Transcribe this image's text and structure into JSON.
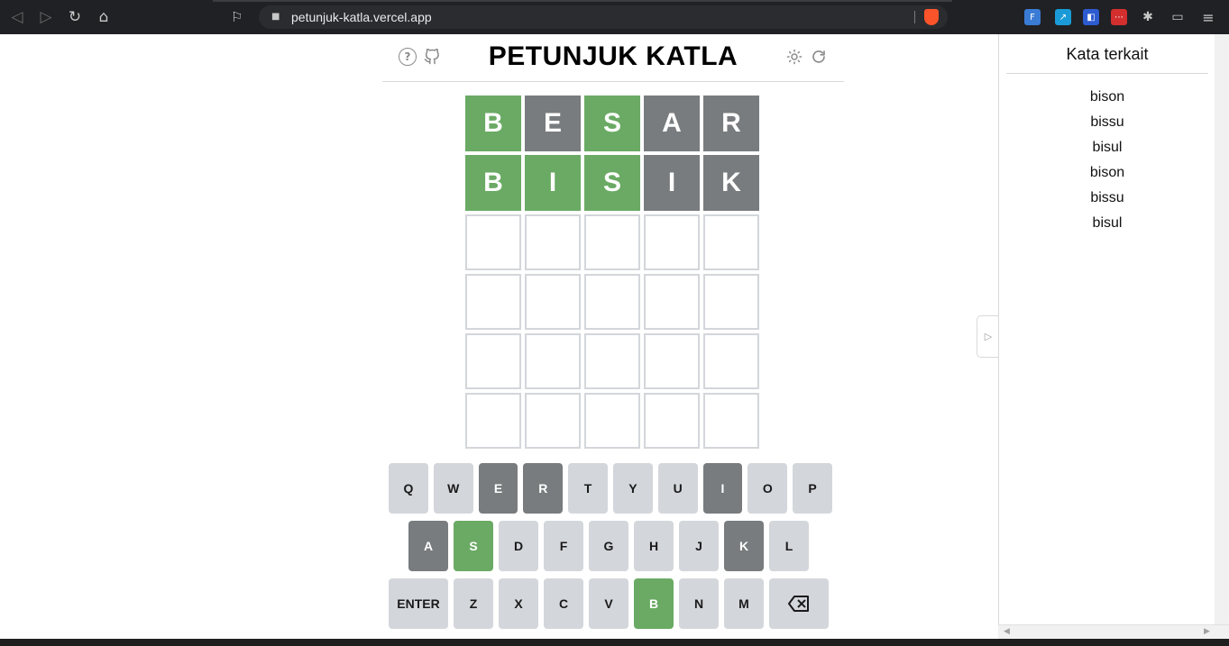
{
  "browser": {
    "url": "petunjuk-katla.vercel.app"
  },
  "app": {
    "title": "PETUNJUK KATLA"
  },
  "board": [
    [
      {
        "l": "B",
        "s": "correct"
      },
      {
        "l": "E",
        "s": "absent"
      },
      {
        "l": "S",
        "s": "correct"
      },
      {
        "l": "A",
        "s": "absent"
      },
      {
        "l": "R",
        "s": "absent"
      }
    ],
    [
      {
        "l": "B",
        "s": "correct"
      },
      {
        "l": "I",
        "s": "correct"
      },
      {
        "l": "S",
        "s": "correct"
      },
      {
        "l": "I",
        "s": "absent"
      },
      {
        "l": "K",
        "s": "absent"
      }
    ],
    [
      {
        "l": "",
        "s": "empty"
      },
      {
        "l": "",
        "s": "empty"
      },
      {
        "l": "",
        "s": "empty"
      },
      {
        "l": "",
        "s": "empty"
      },
      {
        "l": "",
        "s": "empty"
      }
    ],
    [
      {
        "l": "",
        "s": "empty"
      },
      {
        "l": "",
        "s": "empty"
      },
      {
        "l": "",
        "s": "empty"
      },
      {
        "l": "",
        "s": "empty"
      },
      {
        "l": "",
        "s": "empty"
      }
    ],
    [
      {
        "l": "",
        "s": "empty"
      },
      {
        "l": "",
        "s": "empty"
      },
      {
        "l": "",
        "s": "empty"
      },
      {
        "l": "",
        "s": "empty"
      },
      {
        "l": "",
        "s": "empty"
      }
    ],
    [
      {
        "l": "",
        "s": "empty"
      },
      {
        "l": "",
        "s": "empty"
      },
      {
        "l": "",
        "s": "empty"
      },
      {
        "l": "",
        "s": "empty"
      },
      {
        "l": "",
        "s": "empty"
      }
    ]
  ],
  "keyboard": [
    [
      {
        "k": "Q",
        "s": ""
      },
      {
        "k": "W",
        "s": ""
      },
      {
        "k": "E",
        "s": "absent"
      },
      {
        "k": "R",
        "s": "absent"
      },
      {
        "k": "T",
        "s": ""
      },
      {
        "k": "Y",
        "s": ""
      },
      {
        "k": "U",
        "s": ""
      },
      {
        "k": "I",
        "s": "absent"
      },
      {
        "k": "O",
        "s": ""
      },
      {
        "k": "P",
        "s": ""
      }
    ],
    [
      {
        "k": "A",
        "s": "absent"
      },
      {
        "k": "S",
        "s": "correct"
      },
      {
        "k": "D",
        "s": ""
      },
      {
        "k": "F",
        "s": ""
      },
      {
        "k": "G",
        "s": ""
      },
      {
        "k": "H",
        "s": ""
      },
      {
        "k": "J",
        "s": ""
      },
      {
        "k": "K",
        "s": "absent"
      },
      {
        "k": "L",
        "s": ""
      }
    ],
    [
      {
        "k": "ENTER",
        "s": "",
        "wide": true
      },
      {
        "k": "Z",
        "s": ""
      },
      {
        "k": "X",
        "s": ""
      },
      {
        "k": "C",
        "s": ""
      },
      {
        "k": "V",
        "s": ""
      },
      {
        "k": "B",
        "s": "correct"
      },
      {
        "k": "N",
        "s": ""
      },
      {
        "k": "M",
        "s": ""
      },
      {
        "k": "⌫",
        "s": "",
        "wide": true,
        "icon": "backspace-icon"
      }
    ]
  ],
  "sidebar": {
    "title": "Kata terkait",
    "words": [
      "bison",
      "bissu",
      "bisul",
      "bison",
      "bissu",
      "bisul"
    ]
  },
  "colors": {
    "correct": "#6aaa64",
    "absent": "#787c7e",
    "key_default": "#d3d6da",
    "browser_bg": "#202124"
  }
}
